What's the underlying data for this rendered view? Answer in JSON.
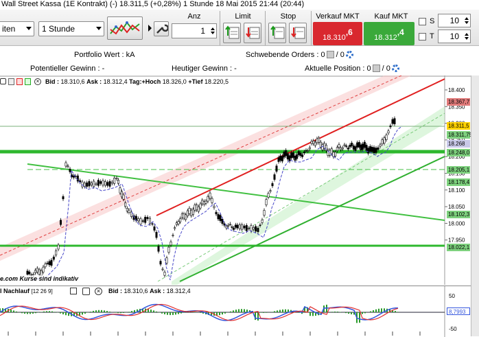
{
  "window": {
    "title": "Wall Street Kassa (1E Kontrakt) (-)    18.311,5 (+0,28%)    1 Stunde   18 Mai 2015 21:44 (20:44)"
  },
  "toolbar": {
    "chart_type_value": "iten",
    "interval_value": "1 Stunde",
    "anz_label": "Anz",
    "anz_value": "1",
    "limit_label": "Limit",
    "stop_label": "Stop",
    "sell_label": "Verkauf MKT",
    "sell_price_main": "18.310",
    "sell_price_frac": ",6",
    "buy_label": "Kauf MKT",
    "buy_price_main": "18.312",
    "buy_price_frac": ",4",
    "s_label": "S",
    "s_value": "10",
    "t_label": "T",
    "t_value": "10",
    "sell_color": "#d9282f",
    "buy_color": "#3aa93a"
  },
  "info": {
    "portfolio_label": "Portfolio Wert :",
    "portfolio_value": "kA",
    "pending_label": "Schwebende Orders :",
    "pending_value": "0",
    "pending_value2": "0",
    "potential_label": "Potentieller Gewinn :",
    "potential_value": "-",
    "today_label": "Heutiger Gewinn :",
    "today_value": "-",
    "position_label": "Aktuelle Position :",
    "position_value": "0",
    "position_value2": "0"
  },
  "chart_header": {
    "bid_label": "Bid :",
    "bid_value": "18.310,6",
    "ask_label": "Ask :",
    "ask_value": "18.312,4",
    "high_label": "Tag:+Hoch",
    "high_value": "18.326,0",
    "low_label": "+Tief",
    "low_value": "18.220,5"
  },
  "chart_note": "e.com    Kurse sind indikativ",
  "price_axis": {
    "ticks": [
      "18.400",
      "18.350",
      "18.300",
      "18.250",
      "18.200",
      "18.150",
      "18.100",
      "18.050",
      "18.000",
      "17.950"
    ]
  },
  "tags": [
    {
      "text": "18.367,7",
      "color": "#e07a7a"
    },
    {
      "text": "18.311,5",
      "color": "#ffd200"
    },
    {
      "text": "18.311,75",
      "color": "#7ed17e"
    },
    {
      "text": "18.268",
      "color": "#c8c8e8"
    },
    {
      "text": "18.248,0",
      "color": "#7ed17e"
    },
    {
      "text": "18.205,1",
      "color": "#7ed17e"
    },
    {
      "text": "18.178,4",
      "color": "#7ed17e"
    },
    {
      "text": "18.102,3",
      "color": "#7ed17e"
    },
    {
      "text": "18.022,1",
      "color": "#7ed17e"
    }
  ],
  "oscillator": {
    "name": "l Nachlauf",
    "params": "[12 26 9]",
    "bid_label": "Bid :",
    "bid_value": "18.310,6",
    "ask_label": "Ask :",
    "ask_value": "18.312,4",
    "ticks": [
      "50",
      "0",
      "-50"
    ],
    "value_tag": "8,7993"
  }
}
